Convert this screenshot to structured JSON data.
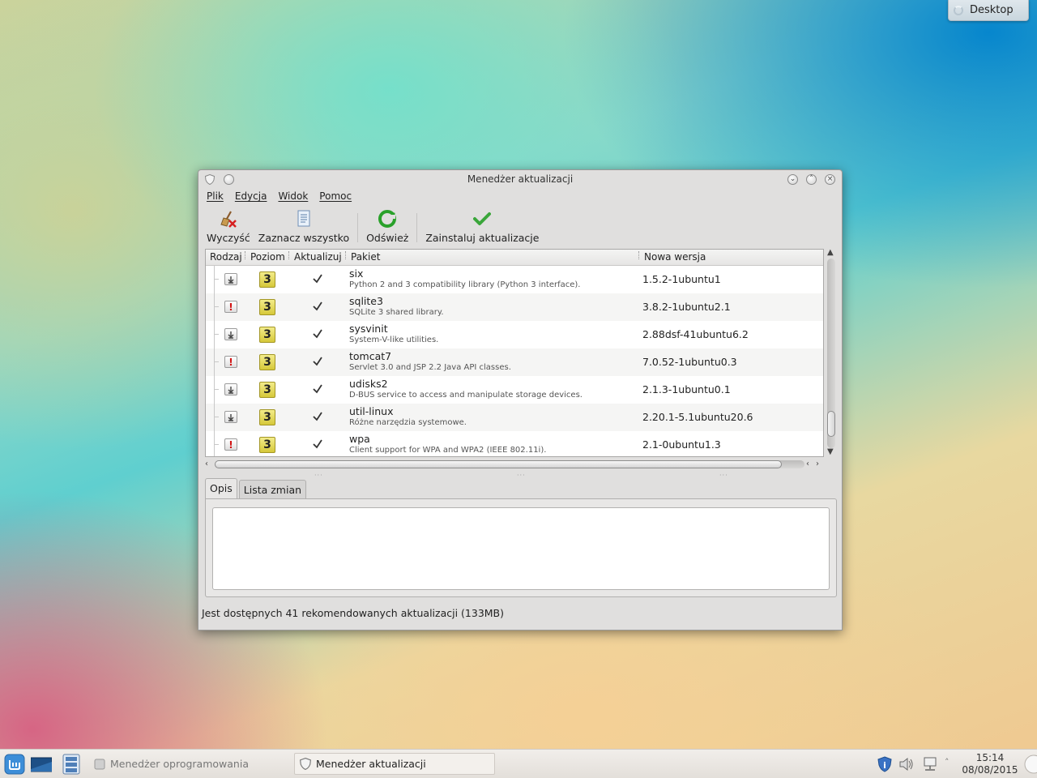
{
  "desktop_widget": {
    "label": "Desktop"
  },
  "window": {
    "title": "Menedżer aktualizacji",
    "menu": [
      "Plik",
      "Edycja",
      "Widok",
      "Pomoc"
    ],
    "toolbar": {
      "clear_label": "Wyczyść",
      "select_all_label": "Zaznacz wszystko",
      "refresh_label": "Odśwież",
      "install_label": "Zainstaluj aktualizacje"
    },
    "columns": [
      "Rodzaj",
      "Poziom",
      "Aktualizuj",
      "Pakiet",
      "Nowa wersja"
    ],
    "rows": [
      {
        "kind": "package",
        "level": "3",
        "checked": true,
        "name": "six",
        "description": "Python 2 and 3 compatibility library (Python 3 interface).",
        "version": "1.5.2-1ubuntu1"
      },
      {
        "kind": "security",
        "level": "3",
        "checked": true,
        "name": "sqlite3",
        "description": "SQLite 3 shared library.",
        "version": "3.8.2-1ubuntu2.1"
      },
      {
        "kind": "package",
        "level": "3",
        "checked": true,
        "name": "sysvinit",
        "description": "System-V-like utilities.",
        "version": "2.88dsf-41ubuntu6.2"
      },
      {
        "kind": "security",
        "level": "3",
        "checked": true,
        "name": "tomcat7",
        "description": "Servlet 3.0 and JSP 2.2 Java API classes.",
        "version": "7.0.52-1ubuntu0.3"
      },
      {
        "kind": "package",
        "level": "3",
        "checked": true,
        "name": "udisks2",
        "description": "D-BUS service to access and manipulate storage devices.",
        "version": "2.1.3-1ubuntu0.1"
      },
      {
        "kind": "package",
        "level": "3",
        "checked": true,
        "name": "util-linux",
        "description": "Różne narzędzia systemowe.",
        "version": "2.20.1-5.1ubuntu20.6"
      },
      {
        "kind": "security",
        "level": "3",
        "checked": true,
        "name": "wpa",
        "description": "Client support for WPA and WPA2 (IEEE 802.11i).",
        "version": "2.1-0ubuntu1.3"
      }
    ],
    "tabs": [
      "Opis",
      "Lista zmian"
    ],
    "active_tab": "Opis",
    "status": "Jest dostępnych 41 rekomendowanych aktualizacji (133MB)"
  },
  "taskbar": {
    "tasks": [
      {
        "label": "Menedżer oprogramowania",
        "active": false
      },
      {
        "label": "Menedżer aktualizacji",
        "active": true
      }
    ],
    "clock": {
      "time": "15:14",
      "date": "08/08/2015"
    }
  },
  "colors": {
    "security": "#d21414",
    "level_badge": "#e6dc5a",
    "refresh": "#2aa12a",
    "install": "#3aa63a"
  }
}
